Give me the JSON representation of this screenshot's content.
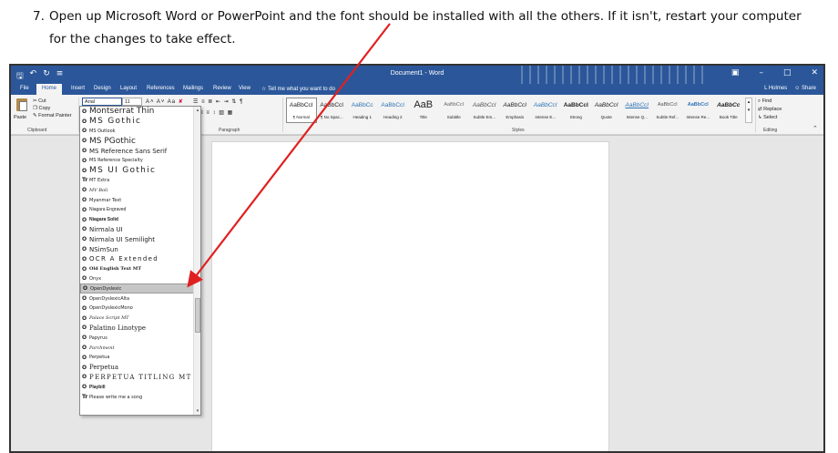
{
  "instruction": {
    "number": "7.",
    "line1": "Open up Microsoft Word or PowerPoint and the font should be installed with all the others. If it isn't, restart your computer",
    "line2": "for the changes to take effect."
  },
  "word": {
    "title": "Document1 - Word",
    "user": "L Holmes",
    "share": "Share",
    "tabs": [
      "File",
      "Home",
      "Insert",
      "Design",
      "Layout",
      "References",
      "Mailings",
      "Review",
      "View",
      "Tell me what you want to do"
    ],
    "clipboard": {
      "paste": "Paste",
      "cut": "Cut",
      "copy": "Copy",
      "format_painter": "Format Painter",
      "label": "Clipboard"
    },
    "font": {
      "name": "Arial",
      "size": "11",
      "paragraph_label": "Paragraph"
    },
    "styles": {
      "label": "Styles",
      "items": [
        {
          "sample": "AaBbCcI",
          "name": "¶ Normal"
        },
        {
          "sample": "AaBbCcI",
          "name": "¶ No Spac..."
        },
        {
          "sample": "AaBbCc",
          "name": "Heading 1"
        },
        {
          "sample": "AaBbCcI",
          "name": "Heading 2"
        },
        {
          "sample": "AaB",
          "name": "Title"
        },
        {
          "sample": "AaBbCcI",
          "name": "Subtitle"
        },
        {
          "sample": "AaBbCcI",
          "name": "Subtle Em..."
        },
        {
          "sample": "AaBbCcI",
          "name": "Emphasis"
        },
        {
          "sample": "AaBbCcI",
          "name": "Intense E..."
        },
        {
          "sample": "AaBbCcI",
          "name": "Strong"
        },
        {
          "sample": "AaBbCcI",
          "name": "Quote"
        },
        {
          "sample": "AaBbCcI",
          "name": "Intense Q..."
        },
        {
          "sample": "AaBbCcI",
          "name": "Subtle Ref..."
        },
        {
          "sample": "AaBbCcI",
          "name": "Intense Re..."
        },
        {
          "sample": "AaBbCc",
          "name": "Book Title"
        }
      ]
    },
    "editing": {
      "find": "Find",
      "replace": "Replace",
      "select": "Select",
      "label": "Editing"
    },
    "font_list": [
      {
        "name": "Montserrat Thin",
        "glyph": "O",
        "style": "big"
      },
      {
        "name": "MS Gothic",
        "glyph": "O",
        "style": "big spaced"
      },
      {
        "name": "MS Outlook",
        "glyph": "O",
        "style": "small"
      },
      {
        "name": "MS PGothic",
        "glyph": "O",
        "style": "big"
      },
      {
        "name": "MS Reference Sans Serif",
        "glyph": "O",
        "style": ""
      },
      {
        "name": "MS Reference Specialty",
        "glyph": "O",
        "style": "small"
      },
      {
        "name": "MS UI Gothic",
        "glyph": "O",
        "style": "big spaced"
      },
      {
        "name": "MT Extra",
        "glyph": "Tr",
        "style": "small"
      },
      {
        "name": "MV Boli",
        "glyph": "O",
        "style": "italic small"
      },
      {
        "name": "Myanmar Text",
        "glyph": "O",
        "style": "small"
      },
      {
        "name": "Niagara Engraved",
        "glyph": "O",
        "style": "cond small"
      },
      {
        "name": "Niagara Solid",
        "glyph": "O",
        "style": "cond small bold"
      },
      {
        "name": "Nirmala UI",
        "glyph": "O",
        "style": ""
      },
      {
        "name": "Nirmala UI Semilight",
        "glyph": "O",
        "style": ""
      },
      {
        "name": "NSimSun",
        "glyph": "O",
        "style": ""
      },
      {
        "name": "OCR A Extended",
        "glyph": "O",
        "style": "spaced"
      },
      {
        "name": "Old English Text MT",
        "glyph": "O",
        "style": "serif bold small"
      },
      {
        "name": "Onyx",
        "glyph": "O",
        "style": "small"
      },
      {
        "name": "OpenDyslexic",
        "glyph": "O",
        "style": "small",
        "selected": true
      },
      {
        "name": "OpenDyslexicAlta",
        "glyph": "O",
        "style": "small"
      },
      {
        "name": "OpenDyslexicMono",
        "glyph": "O",
        "style": "small"
      },
      {
        "name": "Palace Script MT",
        "glyph": "O",
        "style": "italic small"
      },
      {
        "name": "Palatino Linotype",
        "glyph": "O",
        "style": "serif"
      },
      {
        "name": "Papyrus",
        "glyph": "O",
        "style": "small"
      },
      {
        "name": "Parchment",
        "glyph": "O",
        "style": "italic small"
      },
      {
        "name": "Perpetua",
        "glyph": "O",
        "style": "small"
      },
      {
        "name": "Perpetua",
        "glyph": "O",
        "style": "serif"
      },
      {
        "name": "PERPETUA TITLING MT",
        "glyph": "O",
        "style": "serif spaced"
      },
      {
        "name": "Playbill",
        "glyph": "O",
        "style": "cond bold small"
      },
      {
        "name": "Please write me a song",
        "glyph": "Tr",
        "style": "small"
      }
    ],
    "colors": {
      "ribbon_blue": "#2b579a",
      "arrow_red": "#e02020"
    }
  }
}
